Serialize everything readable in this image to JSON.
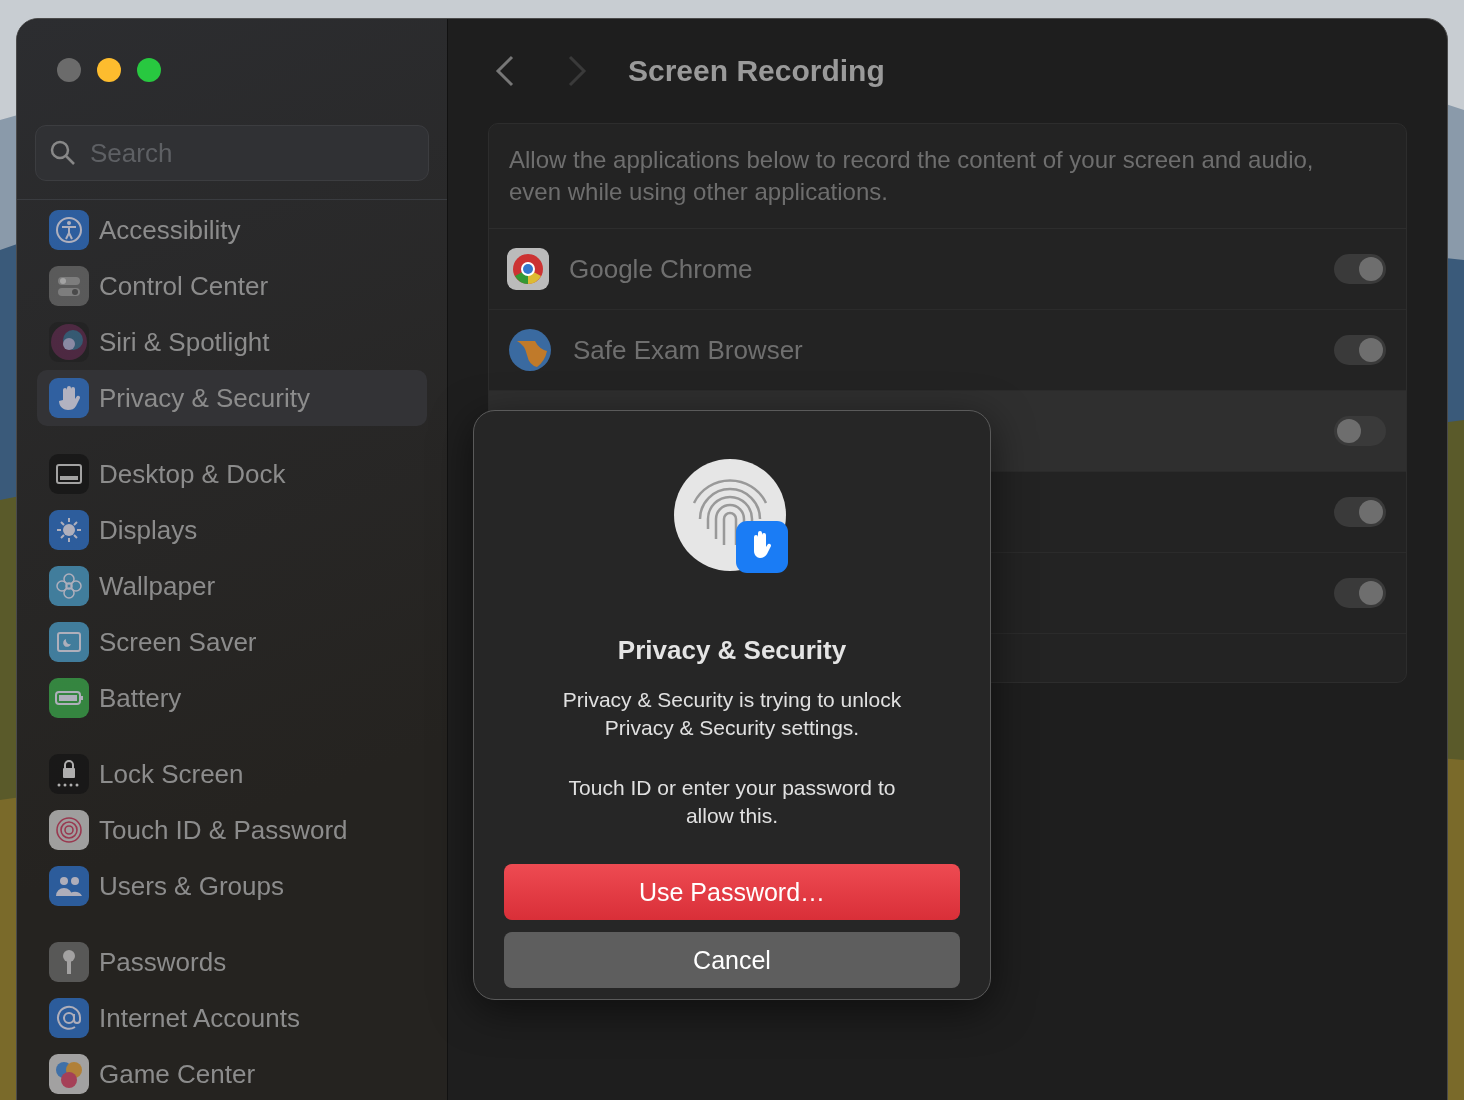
{
  "window": {
    "title": "Screen Recording"
  },
  "search": {
    "placeholder": "Search"
  },
  "sidebar": {
    "groups": [
      {
        "items": [
          {
            "label": "Accessibility",
            "selected": false
          },
          {
            "label": "Control Center",
            "selected": false
          },
          {
            "label": "Siri & Spotlight",
            "selected": false
          },
          {
            "label": "Privacy & Security",
            "selected": true
          }
        ]
      },
      {
        "items": [
          {
            "label": "Desktop & Dock",
            "selected": false
          },
          {
            "label": "Displays",
            "selected": false
          },
          {
            "label": "Wallpaper",
            "selected": false
          },
          {
            "label": "Screen Saver",
            "selected": false
          },
          {
            "label": "Battery",
            "selected": false
          }
        ]
      },
      {
        "items": [
          {
            "label": "Lock Screen",
            "selected": false
          },
          {
            "label": "Touch ID & Password",
            "selected": false
          },
          {
            "label": "Users & Groups",
            "selected": false
          }
        ]
      },
      {
        "items": [
          {
            "label": "Passwords",
            "selected": false
          },
          {
            "label": "Internet Accounts",
            "selected": false
          },
          {
            "label": "Game Center",
            "selected": false
          }
        ]
      }
    ]
  },
  "description": "Allow the applications below to record the content of your screen and audio, even while using other applications.",
  "apps": [
    {
      "name": "Google Chrome",
      "on": true,
      "selected": false
    },
    {
      "name": "Safe Exam Browser",
      "on": true,
      "selected": false
    },
    {
      "on": false,
      "selected": true
    },
    {
      "on": true,
      "selected": false
    },
    {
      "on": true,
      "selected": false
    }
  ],
  "dialog": {
    "title": "Privacy & Security",
    "message": "Privacy & Security is trying to unlock Privacy & Security settings.",
    "prompt": "Touch ID or enter your password to allow this.",
    "buttons": [
      {
        "label": "Use Password…",
        "kind": "primary"
      },
      {
        "label": "Cancel",
        "kind": "secondary"
      }
    ]
  }
}
